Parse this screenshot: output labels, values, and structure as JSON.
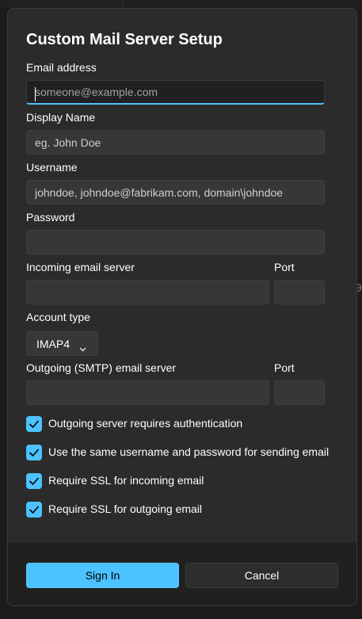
{
  "dialog": {
    "title": "Custom Mail Server Setup"
  },
  "fields": {
    "email": {
      "label": "Email address",
      "placeholder": "someone@example.com",
      "value": ""
    },
    "display_name": {
      "label": "Display Name",
      "placeholder": "eg. John Doe",
      "value": ""
    },
    "username": {
      "label": "Username",
      "placeholder": "johndoe, johndoe@fabrikam.com, domain\\johndoe",
      "value": ""
    },
    "password": {
      "label": "Password",
      "placeholder": "",
      "value": ""
    },
    "incoming_server": {
      "label": "Incoming email server",
      "placeholder": "",
      "value": ""
    },
    "incoming_port": {
      "label": "Port",
      "placeholder": "",
      "value": ""
    },
    "account_type": {
      "label": "Account type",
      "selected": "IMAP4"
    },
    "outgoing_server": {
      "label": "Outgoing (SMTP) email server",
      "placeholder": "",
      "value": ""
    },
    "outgoing_port": {
      "label": "Port",
      "placeholder": "",
      "value": ""
    }
  },
  "checkboxes": [
    {
      "label": "Outgoing server requires authentication",
      "checked": true
    },
    {
      "label": "Use the same username and password for sending email",
      "checked": true
    },
    {
      "label": "Require SSL for incoming email",
      "checked": true
    },
    {
      "label": "Require SSL for outgoing email",
      "checked": true
    }
  ],
  "buttons": {
    "sign_in": "Sign In",
    "cancel": "Cancel"
  },
  "colors": {
    "accent": "#4cc2ff",
    "dialog_bg": "#2b2b2b",
    "input_bg": "#373737",
    "footer_bg": "#202020"
  },
  "icons": {
    "checkbox_check": "check-icon",
    "dropdown": "chevron-down-icon"
  }
}
